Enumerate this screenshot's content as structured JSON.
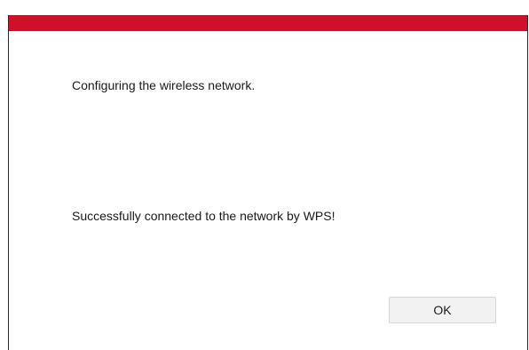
{
  "dialog": {
    "accent_color": "#d0102a",
    "status_message": "Configuring the wireless network.",
    "result_message": "Successfully connected to the network by WPS!",
    "ok_label": "OK"
  }
}
